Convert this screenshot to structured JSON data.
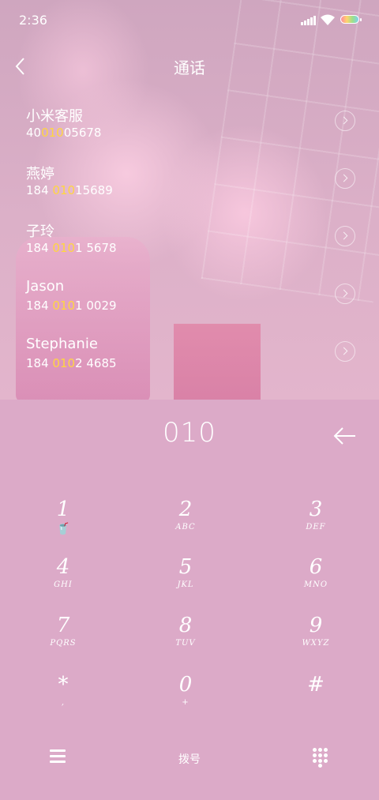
{
  "status_bar": {
    "time": "2:36"
  },
  "header": {
    "title": "通话"
  },
  "contacts": [
    {
      "name": "小米客服",
      "num_pre": "40",
      "num_hl": "010",
      "num_post": "05678"
    },
    {
      "name": "燕婷",
      "num_pre": "184 ",
      "num_hl": "010",
      "num_post": "15689"
    },
    {
      "name": "子玲",
      "num_pre": "184 ",
      "num_hl": "010",
      "num_post": "1 5678"
    },
    {
      "name": "Jason",
      "num_pre": "184 ",
      "num_hl": "010",
      "num_post": "1 0029"
    },
    {
      "name": "Stephanie",
      "num_pre": "184 ",
      "num_hl": "010",
      "num_post": "2 4685"
    }
  ],
  "dialer": {
    "number": "010"
  },
  "keypad": [
    {
      "digit": "1",
      "letters": ""
    },
    {
      "digit": "2",
      "letters": "ABC"
    },
    {
      "digit": "3",
      "letters": "DEF"
    },
    {
      "digit": "4",
      "letters": "GHI"
    },
    {
      "digit": "5",
      "letters": "JKL"
    },
    {
      "digit": "6",
      "letters": "MNO"
    },
    {
      "digit": "7",
      "letters": "PQRS"
    },
    {
      "digit": "8",
      "letters": "TUV"
    },
    {
      "digit": "9",
      "letters": "WXYZ"
    },
    {
      "digit": "*",
      "letters": ","
    },
    {
      "digit": "0",
      "letters": "+"
    },
    {
      "digit": "#",
      "letters": ""
    }
  ],
  "bottom_bar": {
    "dial_label": "拨号"
  },
  "icons": {
    "back": "chevron-left-icon",
    "backspace": "backspace-arrow-icon",
    "menu": "menu-icon",
    "keypad": "keypad-icon",
    "key1": "cup-icon"
  },
  "colors": {
    "highlight": "#ffd640",
    "background": "#dcaac8"
  }
}
